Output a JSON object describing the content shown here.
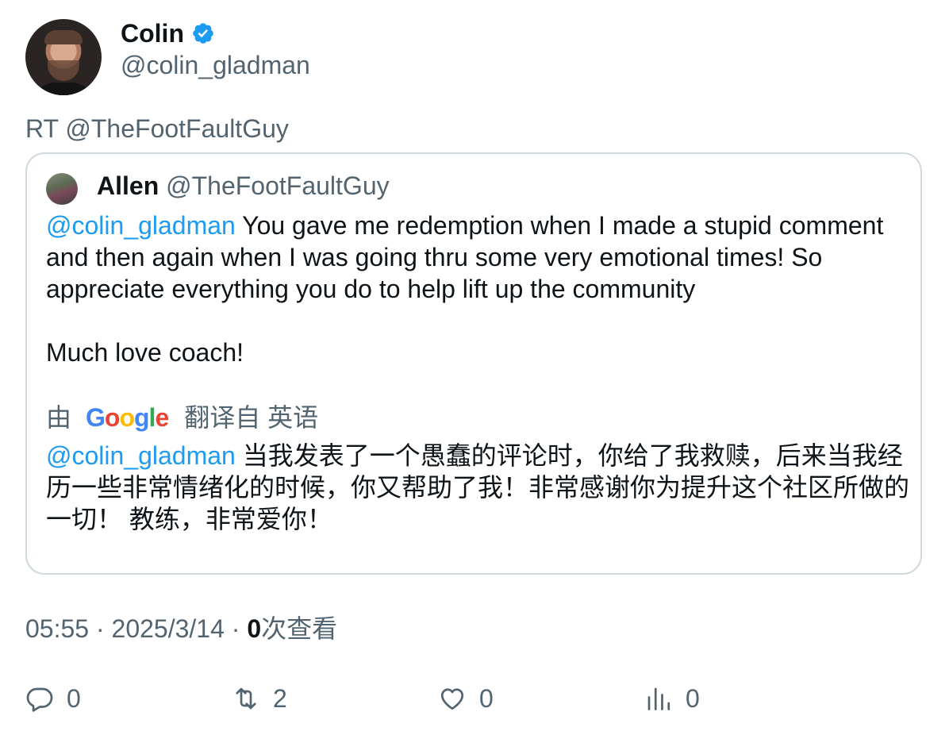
{
  "author": {
    "name": "Colin",
    "handle": "@colin_gladman",
    "verified_color": "#1d9bf0"
  },
  "retweet_label": "RT @TheFootFaultGuy",
  "quoted": {
    "name": "Allen",
    "handle": "@TheFootFaultGuy",
    "mention": "@colin_gladman",
    "text": " You gave me redemption when I made a stupid comment and then again when I was going thru some very emotional times! So appreciate everything you do to help lift up the community\n\nMuch love coach!",
    "translate_prefix": "由",
    "translate_brand": "Google",
    "translate_suffix": "翻译自 英语",
    "translated_mention": "@colin_gladman",
    "translated_text": " 当我发表了一个愚蠢的评论时，你给了我救赎，后来当我经历一些非常情绪化的时候，你又帮助了我！非常感谢你为提升这个社区所做的一切！ 教练，非常爱你！"
  },
  "meta": {
    "time_date": "05:55 · 2025/3/14 · ",
    "views_count": "0",
    "views_label": "次查看"
  },
  "actions": {
    "replies": "0",
    "retweets": "2",
    "likes": "0",
    "views": "0"
  },
  "colors": {
    "accent": "#1d9bf0",
    "secondary_text": "#536471",
    "border": "#cfd9de"
  }
}
